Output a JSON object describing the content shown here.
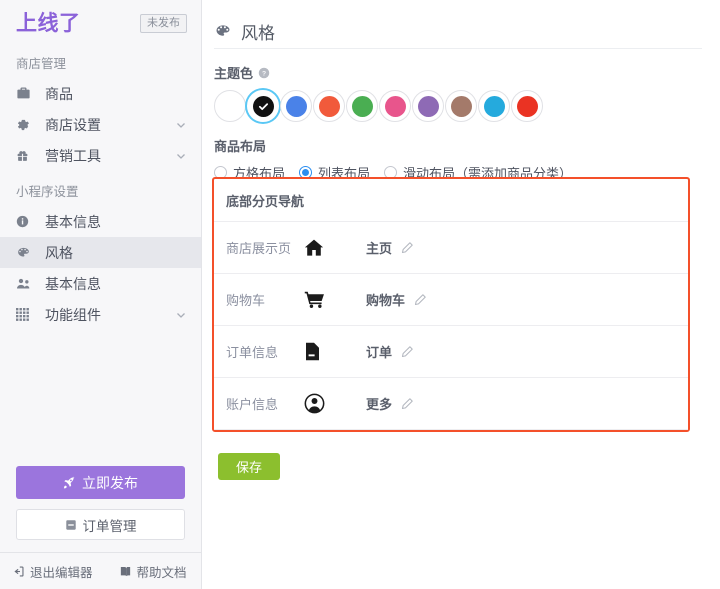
{
  "sidebar": {
    "brand": "上线了",
    "status_badge": "未发布",
    "groups": [
      {
        "title": "商店管理",
        "items": [
          {
            "label": "商品",
            "icon": "briefcase-icon",
            "expandable": false,
            "active": false
          },
          {
            "label": "商店设置",
            "icon": "gear-icon",
            "expandable": true,
            "active": false
          },
          {
            "label": "营销工具",
            "icon": "gift-icon",
            "expandable": true,
            "active": false
          }
        ]
      },
      {
        "title": "小程序设置",
        "items": [
          {
            "label": "基本信息",
            "icon": "info-circle-icon",
            "expandable": false,
            "active": false
          },
          {
            "label": "风格",
            "icon": "palette-icon",
            "expandable": false,
            "active": true
          },
          {
            "label": "基本信息",
            "icon": "users-icon",
            "expandable": false,
            "active": false
          },
          {
            "label": "功能组件",
            "icon": "grid-icon",
            "expandable": true,
            "active": false
          }
        ]
      }
    ],
    "publish_button": "立即发布",
    "orders_button": "订单管理",
    "footer": {
      "exit_editor": "退出编辑器",
      "help_doc": "帮助文档"
    }
  },
  "main": {
    "page_title": "风格",
    "page_icon": "palette-icon",
    "theme_color": {
      "label": "主题色",
      "help_tooltip_icon": "question-circle-icon",
      "selected_index": 1,
      "swatches": [
        {
          "name": "white",
          "hex": "#ffffff"
        },
        {
          "name": "black",
          "hex": "#111111"
        },
        {
          "name": "blue",
          "hex": "#4a82e8"
        },
        {
          "name": "orange-red",
          "hex": "#f15a3b"
        },
        {
          "name": "green",
          "hex": "#4aae52"
        },
        {
          "name": "pink",
          "hex": "#e8558c"
        },
        {
          "name": "purple",
          "hex": "#8e6ab5"
        },
        {
          "name": "brown",
          "hex": "#a47a6a"
        },
        {
          "name": "cyan",
          "hex": "#25aadd"
        },
        {
          "name": "red",
          "hex": "#ea3323"
        }
      ]
    },
    "product_layout": {
      "label": "商品布局",
      "selected_index": 1,
      "options": [
        {
          "label": "方格布局"
        },
        {
          "label": "列表布局"
        },
        {
          "label": "滑动布局（需添加商品分类）"
        }
      ]
    },
    "bottom_nav": {
      "panel_title": "底部分页导航",
      "highlight_color": "#f4502a",
      "rows": [
        {
          "page": "商店展示页",
          "icon": "home-icon",
          "text": "主页",
          "edit_icon": "pencil-icon"
        },
        {
          "page": "购物车",
          "icon": "cart-icon",
          "text": "购物车",
          "edit_icon": "pencil-icon"
        },
        {
          "page": "订单信息",
          "icon": "document-icon",
          "text": "订单",
          "edit_icon": "pencil-icon"
        },
        {
          "page": "账户信息",
          "icon": "user-circle-icon",
          "text": "更多",
          "edit_icon": "pencil-icon"
        }
      ]
    },
    "save_button": "保存"
  }
}
